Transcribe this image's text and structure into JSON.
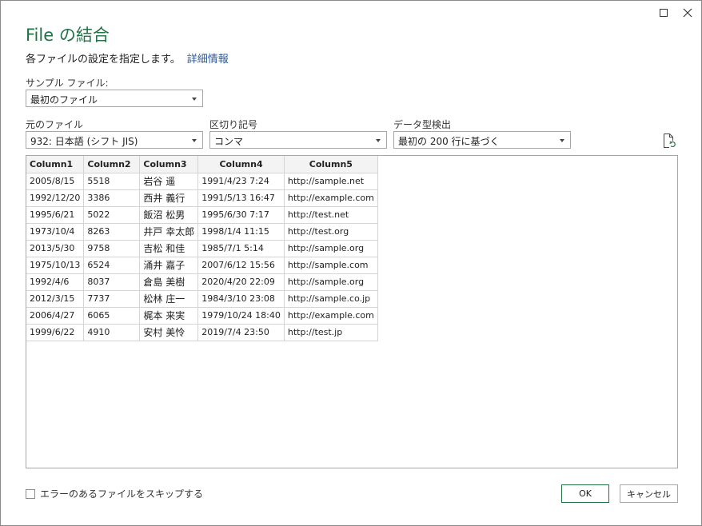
{
  "dialog": {
    "title": "File の結合",
    "subtitle": "各ファイルの設定を指定します。",
    "subtitle_link": "詳細情報"
  },
  "sample_file": {
    "label": "サンプル ファイル:",
    "value": "最初のファイル"
  },
  "origin": {
    "label": "元のファイル",
    "value": "932: 日本語 (シフト JIS)"
  },
  "delimiter": {
    "label": "区切り記号",
    "value": "コンマ"
  },
  "datatype": {
    "label": "データ型検出",
    "value": "最初の 200 行に基づく"
  },
  "preview": {
    "columns": [
      "Column1",
      "Column2",
      "Column3",
      "Column4",
      "Column5"
    ],
    "rows": [
      [
        "2005/8/15",
        "5518",
        "岩谷 遥",
        "1991/4/23 7:24",
        "http://sample.net"
      ],
      [
        "1992/12/20",
        "3386",
        "西井 義行",
        "1991/5/13 16:47",
        "http://example.com"
      ],
      [
        "1995/6/21",
        "5022",
        "飯沼 松男",
        "1995/6/30 7:17",
        "http://test.net"
      ],
      [
        "1973/10/4",
        "8263",
        "井戸 幸太郎",
        "1998/1/4 11:15",
        "http://test.org"
      ],
      [
        "2013/5/30",
        "9758",
        "吉松 和佳",
        "1985/7/1 5:14",
        "http://sample.org"
      ],
      [
        "1975/10/13",
        "6524",
        "涌井 嘉子",
        "2007/6/12 15:56",
        "http://sample.com"
      ],
      [
        "1992/4/6",
        "8037",
        "倉島 美樹",
        "2020/4/20 22:09",
        "http://sample.org"
      ],
      [
        "2012/3/15",
        "7737",
        "松林 庄一",
        "1984/3/10 23:08",
        "http://sample.co.jp"
      ],
      [
        "2006/4/27",
        "6065",
        "梶本 来実",
        "1979/10/24 18:40",
        "http://example.com"
      ],
      [
        "1999/6/22",
        "4910",
        "安村 美怜",
        "2019/7/4 23:50",
        "http://test.jp"
      ]
    ]
  },
  "skip_errors": {
    "label": "エラーのあるファイルをスキップする",
    "checked": false
  },
  "buttons": {
    "ok": "OK",
    "cancel": "キャンセル"
  },
  "colors": {
    "accent": "#217346",
    "link": "#2b579a"
  }
}
